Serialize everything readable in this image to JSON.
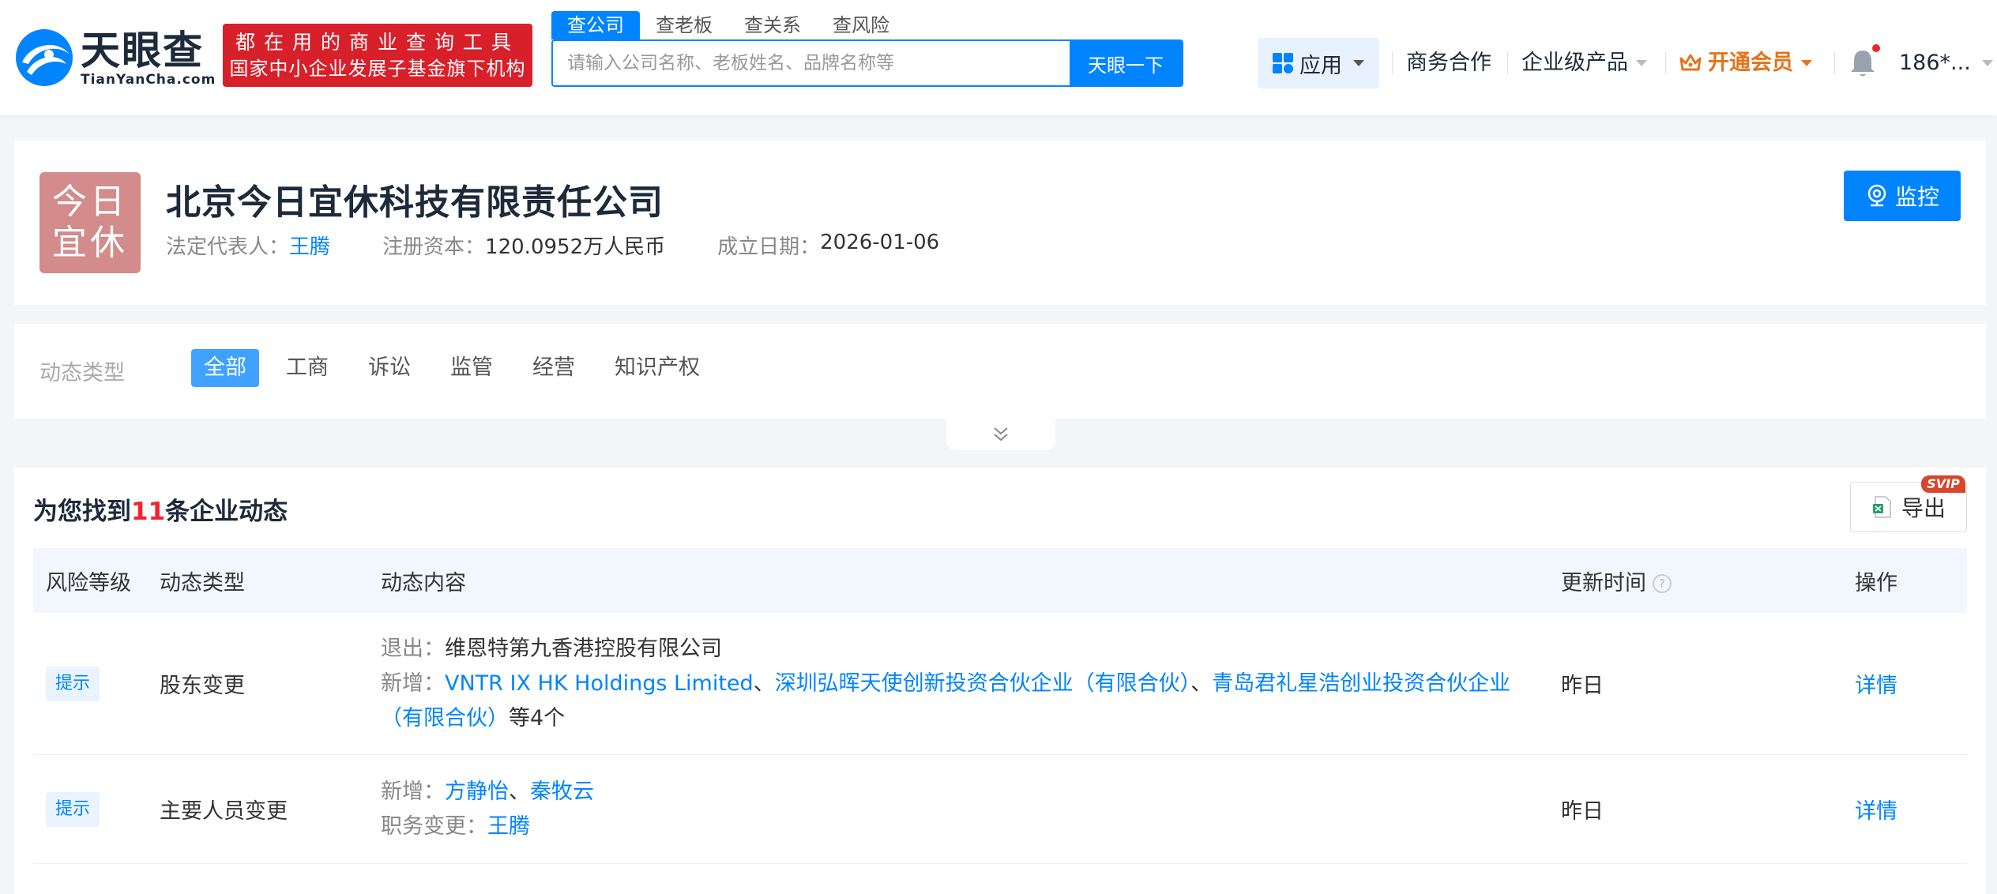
{
  "header": {
    "logo_cn": "天眼查",
    "logo_en": "TianYanCha.com",
    "slogan_line1": "都在用的商业查询工具",
    "slogan_line2": "国家中小企业发展子基金旗下机构",
    "search_tabs": [
      "查公司",
      "查老板",
      "查关系",
      "查风险"
    ],
    "search_placeholder": "请输入公司名称、老板姓名、品牌名称等",
    "search_button": "天眼一下",
    "nav_apps": "应用",
    "nav_business": "商务合作",
    "nav_enterprise": "企业级产品",
    "nav_vip": "开通会员",
    "user": "186*..."
  },
  "company": {
    "logo_text_1": "今日",
    "logo_text_2": "宜休",
    "name": "北京今日宜休科技有限责任公司",
    "legal_rep_label": "法定代表人：",
    "legal_rep": "王腾",
    "capital_label": "注册资本：",
    "capital": "120.0952万人民币",
    "founded_label": "成立日期：",
    "founded": "2026-01-06",
    "monitor_button": "监控"
  },
  "filter": {
    "label": "动态类型",
    "tabs": [
      "全部",
      "工商",
      "诉讼",
      "监管",
      "经营",
      "知识产权"
    ]
  },
  "results": {
    "title_prefix": "为您找到",
    "count": "11",
    "title_suffix": "条企业动态",
    "export_label": "导出",
    "svip_badge": "SVIP",
    "columns": [
      "风险等级",
      "动态类型",
      "动态内容",
      "更新时间",
      "操作"
    ],
    "rows": [
      {
        "risk": "提示",
        "type": "股东变更",
        "exit_label": "退出：",
        "exit_value": "维恩特第九香港控股有限公司",
        "add_label": "新增：",
        "add_links": [
          "VNTR IX HK Holdings Limited",
          "深圳弘晖天使创新投资合伙企业（有限合伙）",
          "青岛君礼星浩创业投资合伙企业（有限合伙）"
        ],
        "separator": "、",
        "add_suffix": "等4个",
        "time": "昨日",
        "action": "详情"
      },
      {
        "risk": "提示",
        "type": "主要人员变更",
        "add_label": "新增：",
        "add_links": [
          "方静怡",
          "秦牧云"
        ],
        "separator": "、",
        "role_label": "职务变更：",
        "role_link": "王腾",
        "time": "昨日",
        "action": "详情"
      }
    ]
  },
  "colors": {
    "primary": "#0084ff",
    "brand_red": "#d8202a",
    "vip_orange": "#e5731a",
    "company_logo_bg": "#d38b8b"
  }
}
